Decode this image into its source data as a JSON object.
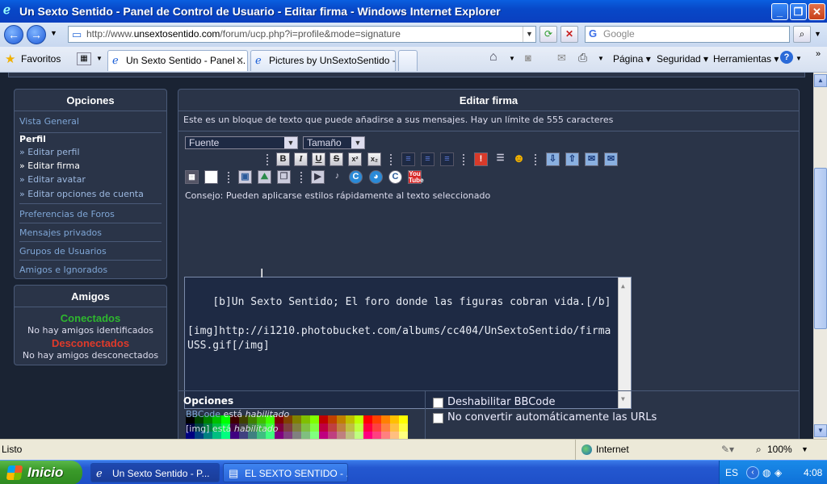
{
  "window": {
    "title": "Un Sexto Sentido - Panel de Control de Usuario - Editar firma - Windows Internet Explorer"
  },
  "browser": {
    "address_prefix": "http://www.",
    "address_domain": "unsextosentido.com",
    "address_suffix": "/forum/ucp.php?i=profile&mode=signature",
    "search_placeholder": "Google",
    "favorites_label": "Favoritos",
    "tabs": [
      {
        "label": "Un Sexto Sentido - Panel ...",
        "active": true
      },
      {
        "label": "Pictures by UnSextoSentido -...",
        "active": false
      }
    ],
    "toolbar": {
      "page": "Página",
      "security": "Seguridad",
      "tools": "Herramientas"
    }
  },
  "sidebar": {
    "options_title": "Opciones",
    "overview": "Vista General",
    "profile_title": "Perfil",
    "profile_items": [
      {
        "label": "» Editar perfil",
        "current": false
      },
      {
        "label": "» Editar firma",
        "current": true
      },
      {
        "label": "» Editar avatar",
        "current": false
      },
      {
        "label": "» Editar opciones de cuenta",
        "current": false
      }
    ],
    "links": [
      "Preferencias de Foros",
      "Mensajes privados",
      "Grupos de Usuarios",
      "Amigos e Ignorados"
    ],
    "friends": {
      "title": "Amigos",
      "online_label": "Conectados",
      "online_text": "No hay amigos identificados",
      "offline_label": "Desconectados",
      "offline_text": "No hay amigos desconectados"
    }
  },
  "main": {
    "title": "Editar firma",
    "description": "Este es un bloque de texto que puede añadirse a sus mensajes. Hay un límite de 555 caracteres",
    "font_select": "Fuente",
    "size_select": "Tamaño",
    "tip": "Consejo: Pueden aplicarse estilos rápidamente al texto seleccionado",
    "signature_text": "[b]Un Sexto Sentido; El foro donde las figuras cobran vida.[/b]\n\n[img]http://i1210.photobucket.com/albums/cc404/UnSextoSentido/firmaUSS.gif[/img]",
    "options_title": "Opciones",
    "bbcode_link": "BBCode",
    "bbcode_is": "está",
    "enabled": "habilitado",
    "img_tag": "[img] está",
    "disable_bbcode": "Deshabilitar BBCode",
    "no_auto_urls": "No convertir automáticamente las URLs"
  },
  "statusbar": {
    "status": "Listo",
    "zone": "Internet",
    "zoom": "100%"
  },
  "taskbar": {
    "start": "Inicio",
    "tasks": [
      {
        "label": "Un Sexto Sentido - P...",
        "active": true
      },
      {
        "label": "EL SEXTO SENTIDO - ...",
        "active": false
      }
    ],
    "lang": "ES",
    "clock": "4:08"
  },
  "colors": {
    "accent": "#7fa6d6",
    "online": "#2eb82e",
    "offline": "#e03a2a"
  }
}
